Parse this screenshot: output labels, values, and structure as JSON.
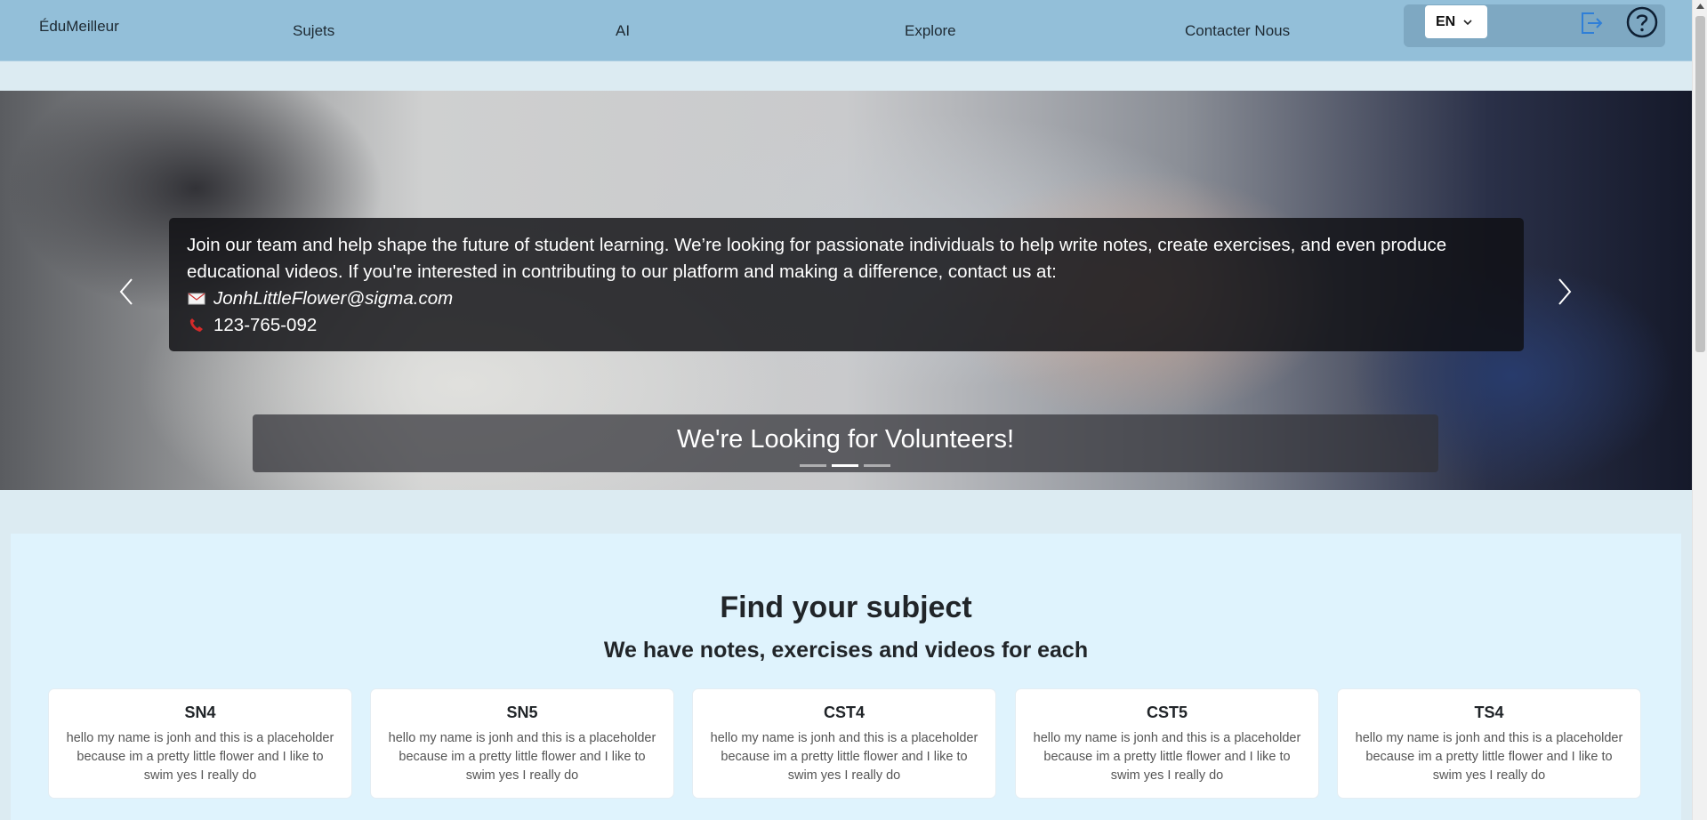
{
  "navbar": {
    "brand": "ÉduMeilleur",
    "links": [
      "Sujets",
      "AI",
      "Explore",
      "Contacter Nous"
    ],
    "language": "EN",
    "icons": [
      "logout-icon",
      "help-icon"
    ]
  },
  "carousel": {
    "caption_text": "Join our team and help shape the future of student learning. We’re looking for passionate individuals to help write notes, create exercises, and even produce educational videos. If you're interested in contributing to our platform and making a difference, contact us at:",
    "email": "JonhLittleFlower@sigma.com",
    "phone": "123-765-092",
    "title": "We're Looking for Volunteers!",
    "indicator_count": 3,
    "active_indicator": 2
  },
  "subjects": {
    "title": "Find your subject",
    "subtitle": "We have notes, exercises and videos for each",
    "cards": [
      {
        "name": "SN4",
        "text": "hello my name is jonh and this is a placeholder because im a pretty little flower and I like to swim yes I really do"
      },
      {
        "name": "SN5",
        "text": "hello my name is jonh and this is a placeholder because im a pretty little flower and I like to swim yes I really do"
      },
      {
        "name": "CST4",
        "text": "hello my name is jonh and this is a placeholder because im a pretty little flower and I like to swim yes I really do"
      },
      {
        "name": "CST5",
        "text": "hello my name is jonh and this is a placeholder because im a pretty little flower and I like to swim yes I really do"
      },
      {
        "name": "TS4",
        "text": "hello my name is jonh and this is a placeholder because im a pretty little flower and I like to swim yes I really do"
      }
    ]
  },
  "colors": {
    "navbar": "#93bfd9",
    "page_background": "#dcebf2",
    "section_background": "#dff3fd",
    "logout_icon": "#2f7fd8"
  }
}
